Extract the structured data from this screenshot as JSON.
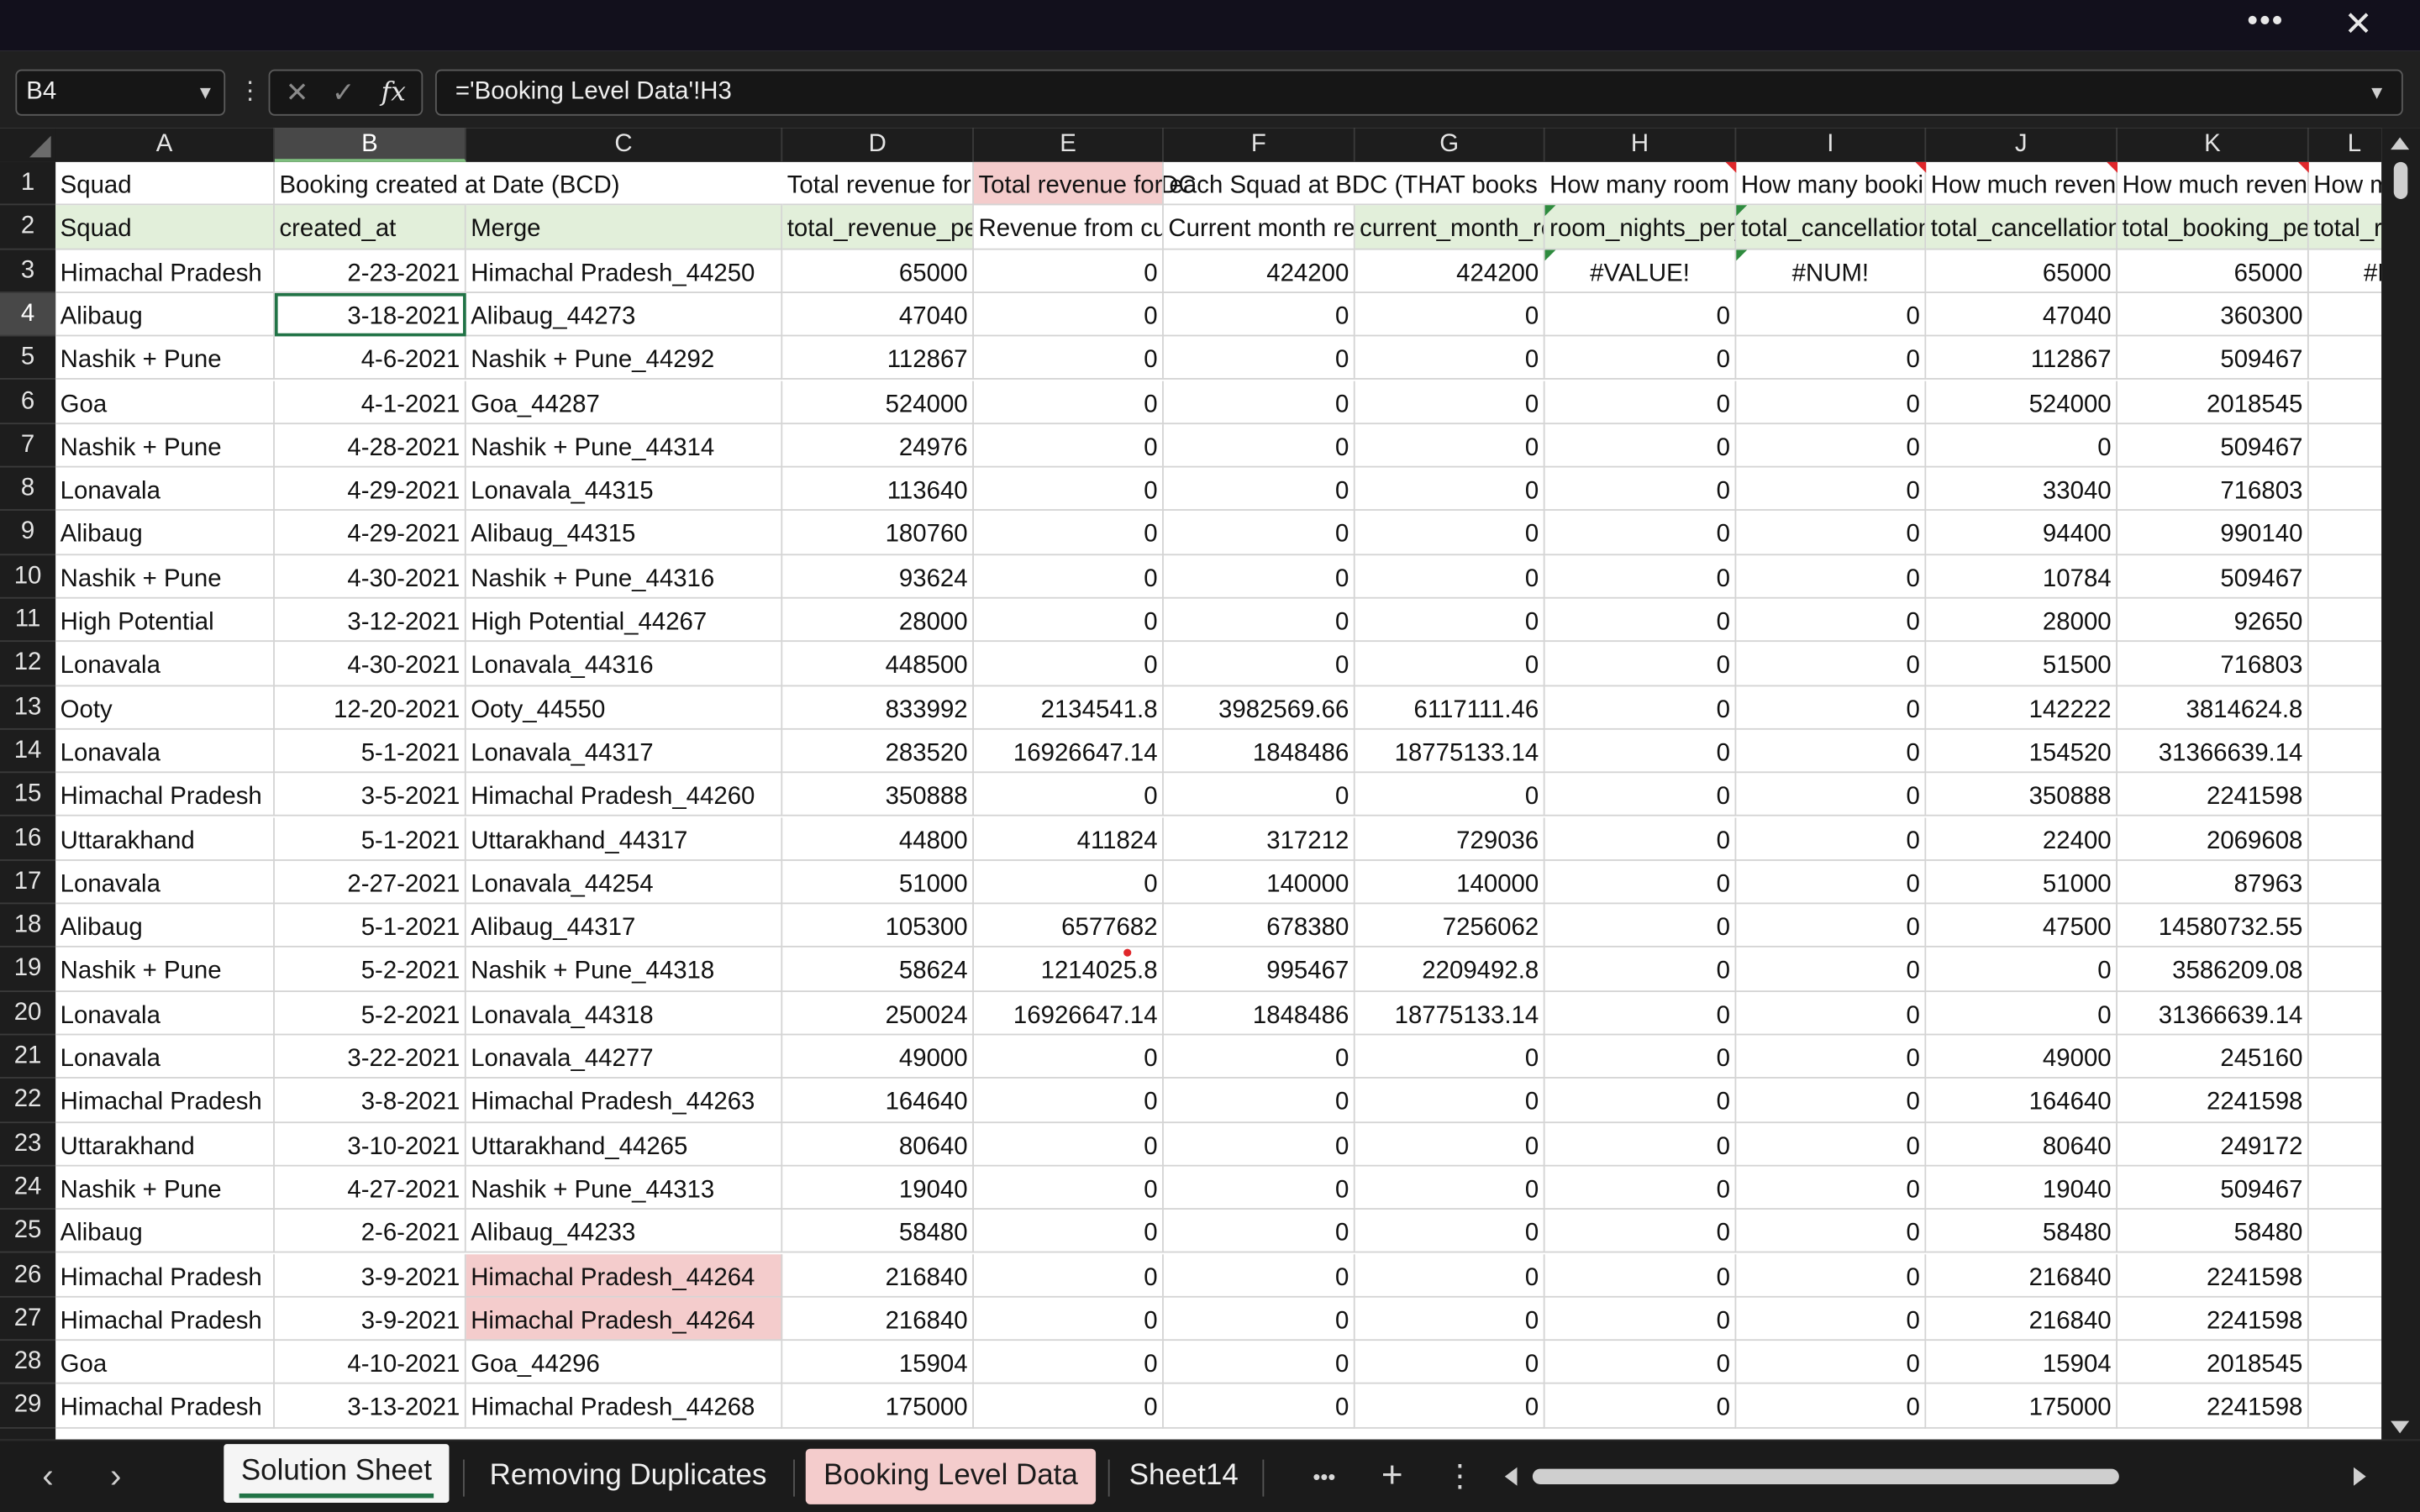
{
  "titlebar": {
    "more_label": "•••",
    "close_label": "✕"
  },
  "formula_bar": {
    "name_box": "B4",
    "formula": "='Booking Level Data'!H3",
    "cancel_icon": "close-icon",
    "enter_icon": "check-icon",
    "function_label": "fx"
  },
  "columns": [
    "A",
    "B",
    "C",
    "D",
    "E",
    "F",
    "G",
    "H",
    "I",
    "J",
    "K",
    "L"
  ],
  "selected_cell": "B4",
  "rows": [
    {
      "n": "1",
      "cells": [
        "Squad",
        "Booking created at Date (BCD)",
        "",
        "Total revenue for each Squad at BDC",
        "Total revenue for each Squad at BDC (THAT books",
        "",
        "",
        "How many room nights",
        "How many bookings",
        "How much revenue",
        "How much revenue",
        "How m"
      ]
    },
    {
      "n": "2",
      "cells": [
        "Squad",
        "created_at",
        "Merge",
        "total_revenue_per_squad",
        "Revenue from current month",
        "Current month revenue",
        "current_month_revenue",
        "room_nights_per_squad",
        "total_cancellations",
        "total_cancellation_revenue",
        "total_booking_per_squad",
        "total_r"
      ]
    },
    {
      "n": "3",
      "cells": [
        "Himachal Pradesh",
        "2-23-2021",
        "Himachal Pradesh_44250",
        "65000",
        "0",
        "424200",
        "424200",
        "#VALUE!",
        "#NUM!",
        "65000",
        "65000",
        "#N"
      ]
    },
    {
      "n": "4",
      "cells": [
        "Alibaug",
        "3-18-2021",
        "Alibaug_44273",
        "47040",
        "0",
        "0",
        "0",
        "0",
        "0",
        "47040",
        "360300",
        ""
      ]
    },
    {
      "n": "5",
      "cells": [
        "Nashik + Pune",
        "4-6-2021",
        "Nashik + Pune_44292",
        "112867",
        "0",
        "0",
        "0",
        "0",
        "0",
        "112867",
        "509467",
        ""
      ]
    },
    {
      "n": "6",
      "cells": [
        "Goa",
        "4-1-2021",
        "Goa_44287",
        "524000",
        "0",
        "0",
        "0",
        "0",
        "0",
        "524000",
        "2018545",
        ""
      ]
    },
    {
      "n": "7",
      "cells": [
        "Nashik + Pune",
        "4-28-2021",
        "Nashik + Pune_44314",
        "24976",
        "0",
        "0",
        "0",
        "0",
        "0",
        "0",
        "509467",
        ""
      ]
    },
    {
      "n": "8",
      "cells": [
        "Lonavala",
        "4-29-2021",
        "Lonavala_44315",
        "113640",
        "0",
        "0",
        "0",
        "0",
        "0",
        "33040",
        "716803",
        ""
      ]
    },
    {
      "n": "9",
      "cells": [
        "Alibaug",
        "4-29-2021",
        "Alibaug_44315",
        "180760",
        "0",
        "0",
        "0",
        "0",
        "0",
        "94400",
        "990140",
        ""
      ]
    },
    {
      "n": "10",
      "cells": [
        "Nashik + Pune",
        "4-30-2021",
        "Nashik + Pune_44316",
        "93624",
        "0",
        "0",
        "0",
        "0",
        "0",
        "10784",
        "509467",
        ""
      ]
    },
    {
      "n": "11",
      "cells": [
        "High Potential",
        "3-12-2021",
        "High Potential_44267",
        "28000",
        "0",
        "0",
        "0",
        "0",
        "0",
        "28000",
        "92650",
        ""
      ]
    },
    {
      "n": "12",
      "cells": [
        "Lonavala",
        "4-30-2021",
        "Lonavala_44316",
        "448500",
        "0",
        "0",
        "0",
        "0",
        "0",
        "51500",
        "716803",
        ""
      ]
    },
    {
      "n": "13",
      "cells": [
        "Ooty",
        "12-20-2021",
        "Ooty_44550",
        "833992",
        "2134541.8",
        "3982569.66",
        "6117111.46",
        "0",
        "0",
        "142222",
        "3814624.8",
        ""
      ]
    },
    {
      "n": "14",
      "cells": [
        "Lonavala",
        "5-1-2021",
        "Lonavala_44317",
        "283520",
        "16926647.14",
        "1848486",
        "18775133.14",
        "0",
        "0",
        "154520",
        "31366639.14",
        ""
      ]
    },
    {
      "n": "15",
      "cells": [
        "Himachal Pradesh",
        "3-5-2021",
        "Himachal Pradesh_44260",
        "350888",
        "0",
        "0",
        "0",
        "0",
        "0",
        "350888",
        "2241598",
        ""
      ]
    },
    {
      "n": "16",
      "cells": [
        "Uttarakhand",
        "5-1-2021",
        "Uttarakhand_44317",
        "44800",
        "411824",
        "317212",
        "729036",
        "0",
        "0",
        "22400",
        "2069608",
        ""
      ]
    },
    {
      "n": "17",
      "cells": [
        "Lonavala",
        "2-27-2021",
        "Lonavala_44254",
        "51000",
        "0",
        "140000",
        "140000",
        "0",
        "0",
        "51000",
        "87963",
        ""
      ]
    },
    {
      "n": "18",
      "cells": [
        "Alibaug",
        "5-1-2021",
        "Alibaug_44317",
        "105300",
        "6577682",
        "678380",
        "7256062",
        "0",
        "0",
        "47500",
        "14580732.55",
        ""
      ]
    },
    {
      "n": "19",
      "cells": [
        "Nashik + Pune",
        "5-2-2021",
        "Nashik + Pune_44318",
        "58624",
        "1214025.8",
        "995467",
        "2209492.8",
        "0",
        "0",
        "0",
        "3586209.08",
        ""
      ]
    },
    {
      "n": "20",
      "cells": [
        "Lonavala",
        "5-2-2021",
        "Lonavala_44318",
        "250024",
        "16926647.14",
        "1848486",
        "18775133.14",
        "0",
        "0",
        "0",
        "31366639.14",
        ""
      ]
    },
    {
      "n": "21",
      "cells": [
        "Lonavala",
        "3-22-2021",
        "Lonavala_44277",
        "49000",
        "0",
        "0",
        "0",
        "0",
        "0",
        "49000",
        "245160",
        ""
      ]
    },
    {
      "n": "22",
      "cells": [
        "Himachal Pradesh",
        "3-8-2021",
        "Himachal Pradesh_44263",
        "164640",
        "0",
        "0",
        "0",
        "0",
        "0",
        "164640",
        "2241598",
        ""
      ]
    },
    {
      "n": "23",
      "cells": [
        "Uttarakhand",
        "3-10-2021",
        "Uttarakhand_44265",
        "80640",
        "0",
        "0",
        "0",
        "0",
        "0",
        "80640",
        "249172",
        ""
      ]
    },
    {
      "n": "24",
      "cells": [
        "Nashik + Pune",
        "4-27-2021",
        "Nashik + Pune_44313",
        "19040",
        "0",
        "0",
        "0",
        "0",
        "0",
        "19040",
        "509467",
        ""
      ]
    },
    {
      "n": "25",
      "cells": [
        "Alibaug",
        "2-6-2021",
        "Alibaug_44233",
        "58480",
        "0",
        "0",
        "0",
        "0",
        "0",
        "58480",
        "58480",
        ""
      ]
    },
    {
      "n": "26",
      "cells": [
        "Himachal Pradesh",
        "3-9-2021",
        "Himachal Pradesh_44264",
        "216840",
        "0",
        "0",
        "0",
        "0",
        "0",
        "216840",
        "2241598",
        ""
      ]
    },
    {
      "n": "27",
      "cells": [
        "Himachal Pradesh",
        "3-9-2021",
        "Himachal Pradesh_44264",
        "216840",
        "0",
        "0",
        "0",
        "0",
        "0",
        "216840",
        "2241598",
        ""
      ]
    },
    {
      "n": "28",
      "cells": [
        "Goa",
        "4-10-2021",
        "Goa_44296",
        "15904",
        "0",
        "0",
        "0",
        "0",
        "0",
        "15904",
        "2018545",
        ""
      ]
    },
    {
      "n": "29",
      "cells": [
        "Himachal Pradesh",
        "3-13-2021",
        "Himachal Pradesh_44268",
        "175000",
        "0",
        "0",
        "0",
        "0",
        "0",
        "175000",
        "2241598",
        ""
      ]
    }
  ],
  "tabs": [
    {
      "label": "Solution Sheet",
      "active": true
    },
    {
      "label": "Removing Duplicates",
      "active": false
    },
    {
      "label": "Booking Level Data",
      "active": false,
      "color": "#f4cccc"
    },
    {
      "label": "Sheet14",
      "active": false
    }
  ],
  "tab_controls": {
    "prev": "‹",
    "next": "›",
    "more": "•••",
    "add": "+",
    "menu": "⋮"
  },
  "colors": {
    "accent": "#217346",
    "header_fill": "#e2efda",
    "duplicate_fill": "#f4cccc",
    "error_marker": "#e0272b"
  }
}
